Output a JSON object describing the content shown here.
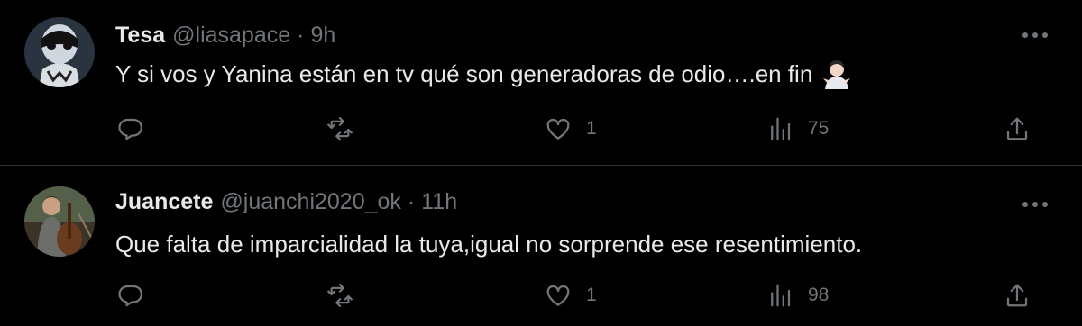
{
  "tweets": [
    {
      "name": "Tesa",
      "handle": "@liasapace",
      "separator": "·",
      "time": "9h",
      "text": "Y si vos y Yanina están en tv qué son generadoras de odio….en fin",
      "emoji": "person-shrugging-emoji",
      "likes": "1",
      "views": "75"
    },
    {
      "name": "Juancete",
      "handle": "@juanchi2020_ok",
      "separator": "·",
      "time": "11h",
      "text": "Que falta de imparcialidad la tuya,igual no sorprende ese resentimiento.",
      "likes": "1",
      "views": "98"
    }
  ],
  "colors": {
    "background": "#000000",
    "text": "#e7e9ea",
    "muted": "#71767b",
    "divider": "#2f3336"
  }
}
